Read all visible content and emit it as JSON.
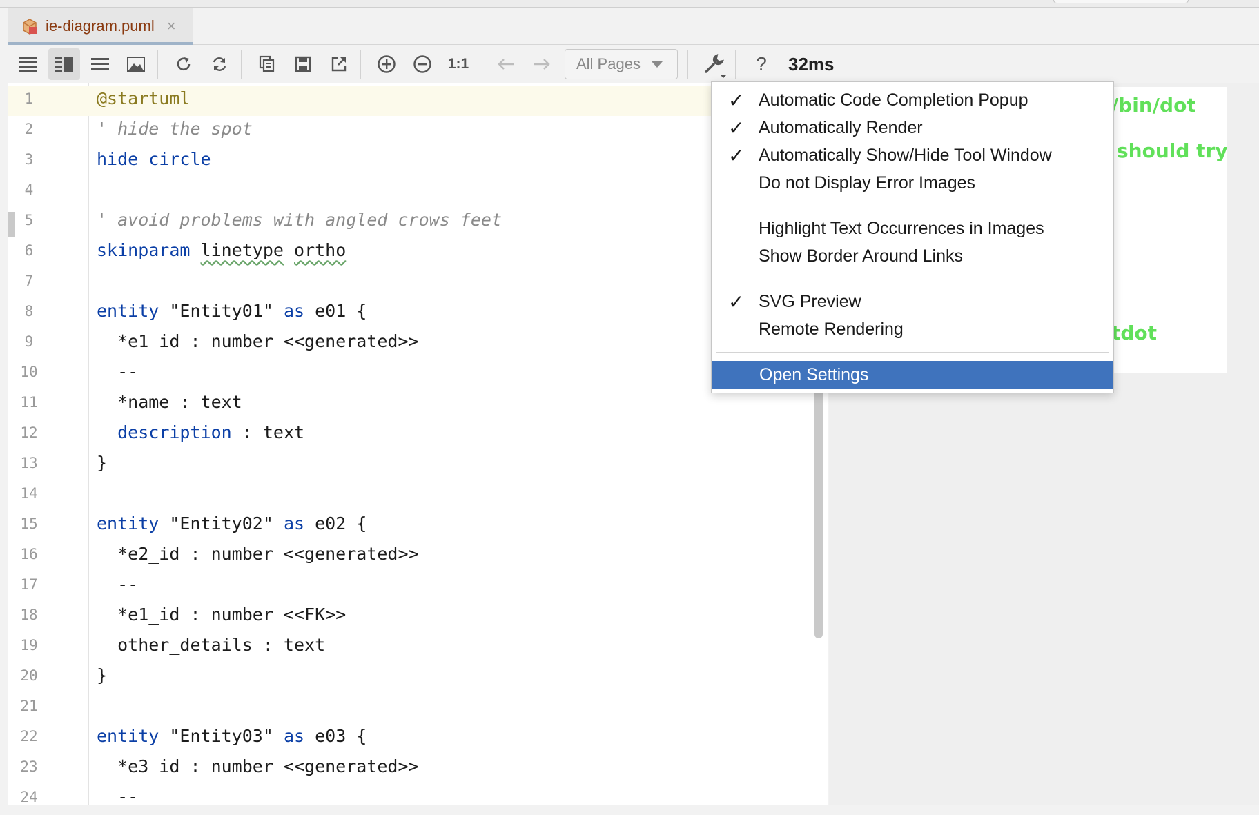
{
  "tab": {
    "title": "ie-diagram.puml",
    "close": "×"
  },
  "toolbar": {
    "pages_select": "All Pages",
    "zoom_reset": "1:1",
    "help": "?",
    "timing": "32ms"
  },
  "editor": {
    "lines": [
      {
        "n": "1"
      },
      {
        "n": "2"
      },
      {
        "n": "3"
      },
      {
        "n": "4"
      },
      {
        "n": "5"
      },
      {
        "n": "6"
      },
      {
        "n": "7"
      },
      {
        "n": "8"
      },
      {
        "n": "9"
      },
      {
        "n": "10"
      },
      {
        "n": "11"
      },
      {
        "n": "12"
      },
      {
        "n": "13"
      },
      {
        "n": "14"
      },
      {
        "n": "15"
      },
      {
        "n": "16"
      },
      {
        "n": "17"
      },
      {
        "n": "18"
      },
      {
        "n": "19"
      },
      {
        "n": "20"
      },
      {
        "n": "21"
      },
      {
        "n": "22"
      },
      {
        "n": "23"
      },
      {
        "n": "24"
      }
    ],
    "code": {
      "l1": "@startuml",
      "l2": "' hide the spot",
      "l3_kw": "hide",
      "l3_rest": "circle",
      "l5": "' avoid problems with angled crows feet",
      "l6_kw": "skinparam",
      "l6_a": "linetype",
      "l6_b": "ortho",
      "l8_kw": "entity",
      "l8_name": "\"Entity01\"",
      "l8_as": "as",
      "l8_rest": "e01 {",
      "l9": "  *e1_id : number <<generated>>",
      "l10": "  --",
      "l11": "  *name : text",
      "l12_kw": "description",
      "l12_rest": " : text",
      "l13": "}",
      "l15_kw": "entity",
      "l15_name": "\"Entity02\"",
      "l15_as": "as",
      "l15_rest": "e02 {",
      "l16": "  *e2_id : number <<generated>>",
      "l17": "  --",
      "l18": "  *e1_id : number <<FK>>",
      "l19": "  other_details : text",
      "l20": "}",
      "l22_kw": "entity",
      "l22_name": "\"Entity03\"",
      "l22_as": "as",
      "l22_rest": "e03 {",
      "l23": "  *e3_id : number <<generated>>",
      "l24": "  --"
    }
  },
  "preview": {
    "text1": "/bin/dot",
    "text2": "should try",
    "text3": "tdot"
  },
  "menu": {
    "items": [
      {
        "label": "Automatic Code Completion Popup",
        "checked": "✓"
      },
      {
        "label": "Automatically Render",
        "checked": "✓"
      },
      {
        "label": "Automatically Show/Hide Tool Window",
        "checked": "✓"
      },
      {
        "label": "Do not Display Error Images",
        "checked": ""
      },
      {
        "label": "Highlight Text Occurrences in Images",
        "checked": ""
      },
      {
        "label": "Show Border Around Links",
        "checked": ""
      },
      {
        "label": "SVG Preview",
        "checked": "✓"
      },
      {
        "label": "Remote Rendering",
        "checked": ""
      },
      {
        "label": "Open Settings",
        "checked": ""
      }
    ]
  },
  "colors": {
    "accent_selection": "#3f73bd",
    "keyword": "#0b3fa6",
    "preview_text": "#61e05a",
    "tab_title": "#8a3a10"
  }
}
